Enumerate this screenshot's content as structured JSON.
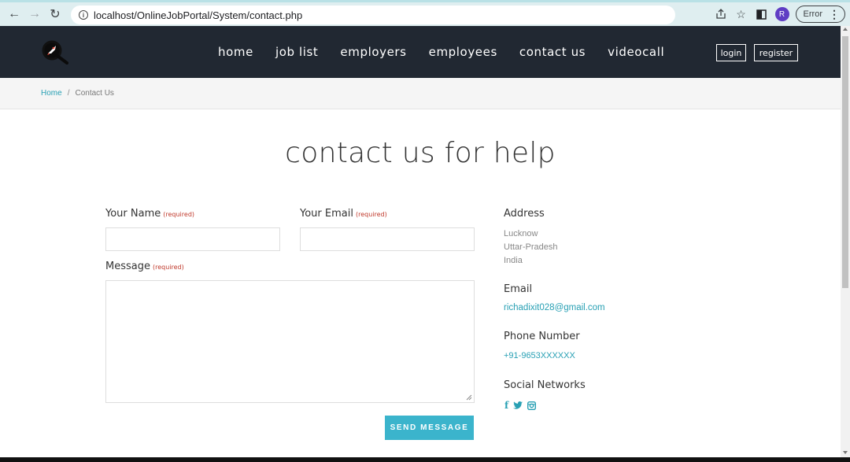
{
  "browser": {
    "url": "localhost/OnlineJobPortal/System/contact.php",
    "profile_initial": "R",
    "error_label": "Error"
  },
  "nav": {
    "links": [
      "home",
      "job list",
      "employers",
      "employees",
      "contact us",
      "videocall"
    ],
    "login_label": "login",
    "register_label": "register"
  },
  "breadcrumb": {
    "home": "Home",
    "separator": "/",
    "current": "Contact Us"
  },
  "page": {
    "title": "contact us for help"
  },
  "form": {
    "name_label": "Your Name",
    "email_label": "Your Email",
    "message_label": "Message",
    "required_text": "(required)",
    "name_value": "",
    "email_value": "",
    "message_value": "",
    "submit_label": "SEND MESSAGE"
  },
  "contact_info": {
    "address_heading": "Address",
    "address_lines": [
      "Lucknow",
      "Uttar-Pradesh",
      "India"
    ],
    "email_heading": "Email",
    "email": "richadixit028@gmail.com",
    "phone_heading": "Phone Number",
    "phone": "+91-9653XXXXXX",
    "social_heading": "Social Networks",
    "social_icons": [
      "facebook-icon",
      "twitter-icon",
      "instagram-icon"
    ]
  },
  "colors": {
    "nav_bg": "#212832",
    "accent": "#3bb4cc",
    "link": "#28a0b4",
    "required": "#c0392b"
  }
}
